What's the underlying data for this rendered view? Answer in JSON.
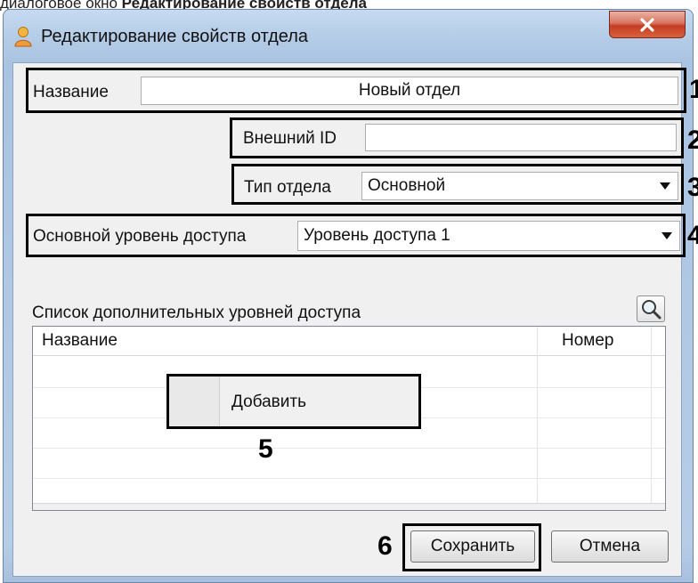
{
  "caption": {
    "prefix": "диалоговое окно",
    "bold": "Редактирование свойств отдела"
  },
  "window": {
    "title": "Редактирование свойств отдела"
  },
  "fields": {
    "name_label": "Название",
    "name_value": "Новый отдел",
    "external_id_label": "Внешний ID",
    "external_id_value": "",
    "dept_type_label": "Тип отдела",
    "dept_type_value": "Основной",
    "access_level_label": "Основной уровень доступа",
    "access_level_value": "Уровень доступа 1"
  },
  "extra_levels": {
    "label": "Список дополнительных уровней доступа",
    "columns": [
      "Название",
      "Номер"
    ],
    "rows": []
  },
  "context_menu": {
    "add_label": "Добавить"
  },
  "buttons": {
    "save": "Сохранить",
    "cancel": "Отмена"
  },
  "callouts": {
    "c1": "1",
    "c2": "2",
    "c3": "3",
    "c4": "4",
    "c5": "5",
    "c6": "6"
  },
  "icons": {
    "window_icon": "user-icon",
    "close": "close-icon",
    "search": "magnifier-icon"
  }
}
